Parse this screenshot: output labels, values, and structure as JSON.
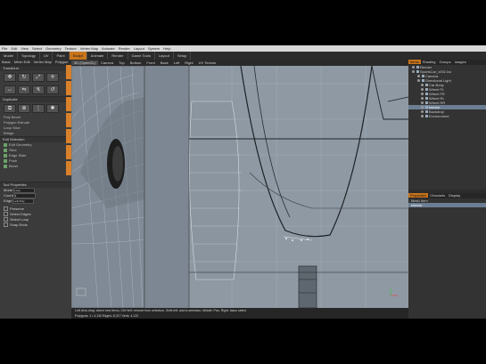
{
  "menu": [
    "File",
    "Edit",
    "View",
    "Select",
    "Geometry",
    "Texture",
    "Vertex Map",
    "Animate",
    "Render",
    "Layout",
    "System",
    "Help"
  ],
  "modes": [
    "Model",
    "Topology",
    "UV",
    "Paint",
    "Sculpt",
    "Animate",
    "Render",
    "Game Tools",
    "Layout",
    "Setup"
  ],
  "active_mode": "Sculpt",
  "left": {
    "tabs": [
      "Basic",
      "Mesh Edit",
      "Vertex Map",
      "Polygon"
    ],
    "header_transform": "Transform",
    "header_duplicate": "Duplicate",
    "tools": [
      "Poly Bevel",
      "Polygon Extrude",
      "Loop Slice",
      "Bridge"
    ],
    "section_groups": "Edit Selection",
    "groups": [
      "Edit Geometry",
      "Slice",
      "Edge Slide",
      "Push",
      "Bevel"
    ],
    "props_header": "Tool Properties",
    "props": [
      {
        "label": "Mode",
        "value": "Loop"
      },
      {
        "label": "Count",
        "value": "1"
      },
      {
        "label": "Edge",
        "value": "Left Only"
      }
    ],
    "checks": [
      "Preserve",
      "Select Edges",
      "Select Loop",
      "Snap Ends"
    ]
  },
  "viewport": {
    "tabs": [
      "3D (OpenGL)",
      "Camera",
      "Top",
      "Bottom",
      "Front",
      "Back",
      "Left",
      "Right",
      "UV Texture"
    ],
    "selected_tab": "3D (OpenGL)",
    "info_line1": "Left click-drag: select new items, Ctrl+left: remove from selection, Shift-left: add to selection, Middle: Pan, Right: lasso select",
    "info_line2": "Polygons: 1 / 4,130    Edges: 8,217    Verts: 4,122"
  },
  "right": {
    "tabs": [
      "Items",
      "Shading",
      "Groups",
      "Images"
    ],
    "selected_tab": "Items",
    "items": [
      {
        "label": "Render",
        "sel": false
      },
      {
        "label": "SportsCar_v002.lxo",
        "sel": false
      },
      {
        "label": "Camera",
        "sel": false
      },
      {
        "label": "Directional Light",
        "sel": false
      },
      {
        "label": "Car Body",
        "sel": false
      },
      {
        "label": "Wheel FL",
        "sel": false
      },
      {
        "label": "Wheel FR",
        "sel": false
      },
      {
        "label": "Wheel RL",
        "sel": false
      },
      {
        "label": "Wheel RR",
        "sel": false
      },
      {
        "label": "Interior",
        "sel": true
      },
      {
        "label": "Backdrop",
        "sel": false
      },
      {
        "label": "Environment",
        "sel": false
      }
    ],
    "bottom_tabs": [
      "Properties",
      "Channels",
      "Display"
    ],
    "bottom_selected": "Properties",
    "bottom_items": [
      "Mesh Item",
      "Interior"
    ]
  },
  "colors": {
    "accent": "#c8751d",
    "viewport_bg": "#8e99a4",
    "selection": "#6b7e93"
  }
}
